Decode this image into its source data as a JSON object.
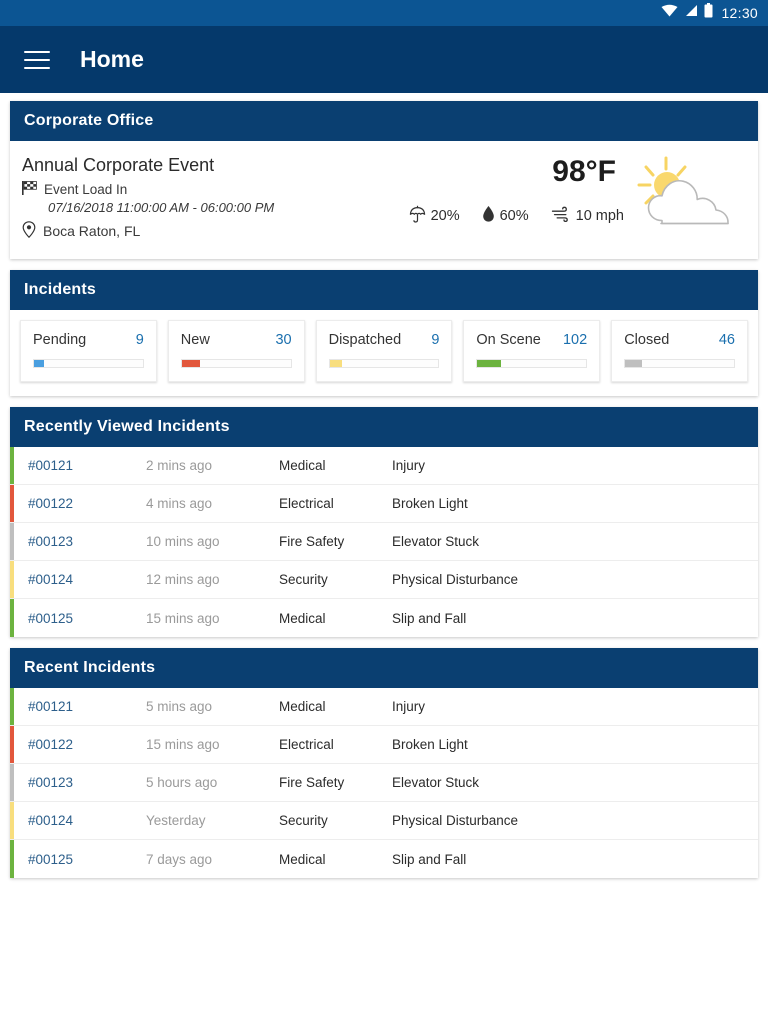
{
  "status_bar": {
    "time": "12:30",
    "icons": [
      "wifi-icon",
      "signal-icon",
      "battery-icon"
    ]
  },
  "app_bar": {
    "menu_icon": "hamburger-menu-icon",
    "title": "Home"
  },
  "event_card": {
    "header": "Corporate Office",
    "title": "Annual Corporate Event",
    "phase_icon": "checkered-flag-icon",
    "phase": "Event Load In",
    "date_range": "07/16/2018 11:00:00 AM - 06:00:00 PM",
    "location_icon": "location-pin-icon",
    "location": "Boca Raton, FL",
    "weather": {
      "temperature": "98°F",
      "condition_icon": "sun-behind-cloud-icon",
      "metrics": [
        {
          "icon": "umbrella-icon",
          "value": "20%"
        },
        {
          "icon": "water-drop-icon",
          "value": "60%"
        },
        {
          "icon": "wind-icon",
          "value": "10 mph"
        }
      ]
    }
  },
  "incidents_card": {
    "header": "Incidents",
    "stats": [
      {
        "label": "Pending",
        "value": "9",
        "color": "#4a9fe0",
        "percent": 9
      },
      {
        "label": "New",
        "value": "30",
        "color": "#e2573c",
        "percent": 17
      },
      {
        "label": "Dispatched",
        "value": "9",
        "color": "#f8de7e",
        "percent": 11
      },
      {
        "label": "On Scene",
        "value": "102",
        "color": "#6cb33f",
        "percent": 22
      },
      {
        "label": "Closed",
        "value": "46",
        "color": "#bfbfbf",
        "percent": 15
      }
    ]
  },
  "recently_viewed_card": {
    "header": "Recently Viewed Incidents",
    "rows": [
      {
        "stripe": "#6cb33f",
        "id": "#00121",
        "time": "2 mins ago",
        "type": "Medical",
        "description": "Injury"
      },
      {
        "stripe": "#e2573c",
        "id": "#00122",
        "time": "4 mins ago",
        "type": "Electrical",
        "description": "Broken Light"
      },
      {
        "stripe": "#bfbfbf",
        "id": "#00123",
        "time": "10 mins ago",
        "type": "Fire Safety",
        "description": "Elevator Stuck"
      },
      {
        "stripe": "#f8de7e",
        "id": "#00124",
        "time": "12 mins ago",
        "type": "Security",
        "description": "Physical Disturbance"
      },
      {
        "stripe": "#6cb33f",
        "id": "#00125",
        "time": "15 mins ago",
        "type": "Medical",
        "description": "Slip and Fall"
      }
    ]
  },
  "recent_card": {
    "header": "Recent Incidents",
    "rows": [
      {
        "stripe": "#6cb33f",
        "id": "#00121",
        "time": "5 mins ago",
        "type": "Medical",
        "description": "Injury"
      },
      {
        "stripe": "#e2573c",
        "id": "#00122",
        "time": "15 mins ago",
        "type": "Electrical",
        "description": "Broken Light"
      },
      {
        "stripe": "#bfbfbf",
        "id": "#00123",
        "time": "5 hours ago",
        "type": "Fire Safety",
        "description": "Elevator Stuck"
      },
      {
        "stripe": "#f8de7e",
        "id": "#00124",
        "time": "Yesterday",
        "type": "Security",
        "description": "Physical Disturbance"
      },
      {
        "stripe": "#6cb33f",
        "id": "#00125",
        "time": "7 days ago",
        "type": "Medical",
        "description": "Slip and Fall"
      }
    ]
  },
  "theme": {
    "status_bar_blue": "#0c5593",
    "app_bar_blue": "#05396b",
    "card_header_blue": "#0a3f71",
    "link_blue": "#2d5f8b"
  }
}
